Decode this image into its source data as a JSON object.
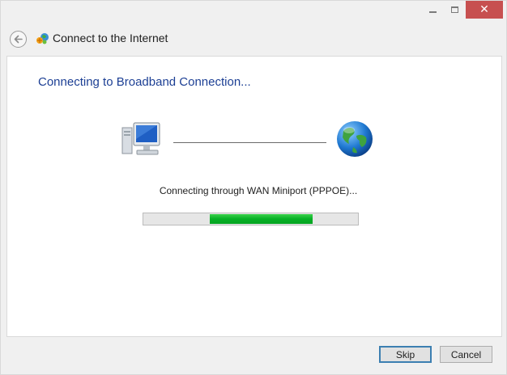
{
  "window": {
    "caption_buttons": {
      "minimize": "minimize-icon",
      "maximize": "maximize-icon",
      "close": "close-icon"
    },
    "title": "Connect to the Internet",
    "icons": {
      "back": "back-arrow-icon",
      "wizard": "network-wizard-icon"
    }
  },
  "main": {
    "heading": "Connecting to Broadband Connection...",
    "icons": {
      "source": "computer-icon",
      "destination": "globe-icon"
    },
    "status": "Connecting through WAN Miniport (PPPOE)...",
    "progress": {
      "indeterminate": true,
      "segment_start_fraction": 0.31,
      "segment_width_fraction": 0.48,
      "color": "#06b025"
    }
  },
  "footer": {
    "skip_label": "Skip",
    "cancel_label": "Cancel"
  },
  "colors": {
    "heading": "#1c3f94",
    "close_button": "#c75050",
    "default_button_border": "#3c7fb1"
  }
}
